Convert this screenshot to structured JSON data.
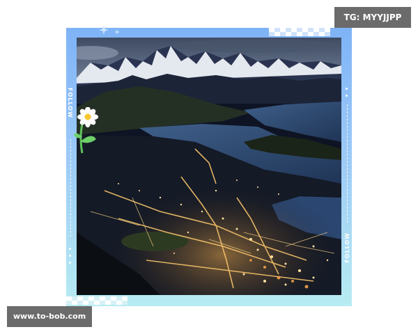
{
  "watermarks": {
    "top_right": "TG: MYYJJPP",
    "bottom_left": "www.to-bob.com"
  },
  "frame": {
    "left_vertical_text": "FOLLOW",
    "right_vertical_text": "FOLLOW",
    "gradient_top": "#7eb3f7",
    "gradient_bottom": "#b7ecf2"
  },
  "photo": {
    "subject": "night-city-lake-mountains"
  }
}
